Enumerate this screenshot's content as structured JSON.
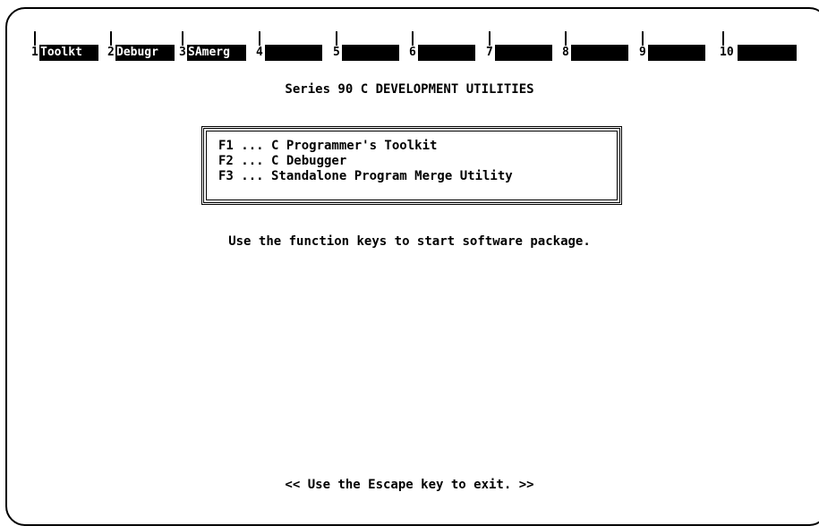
{
  "function_keys": [
    {
      "number": "1",
      "label": "Toolkt"
    },
    {
      "number": "2",
      "label": "Debugr"
    },
    {
      "number": "3",
      "label": "SAmerg"
    },
    {
      "number": "4",
      "label": ""
    },
    {
      "number": "5",
      "label": ""
    },
    {
      "number": "6",
      "label": ""
    },
    {
      "number": "7",
      "label": ""
    },
    {
      "number": "8",
      "label": ""
    },
    {
      "number": "9",
      "label": ""
    },
    {
      "number": "10",
      "label": ""
    }
  ],
  "title": "Series 90 C DEVELOPMENT UTILITIES",
  "menu": {
    "items": [
      {
        "text": "F1 ... C Programmer's Toolkit"
      },
      {
        "text": "F2 ... C Debugger"
      },
      {
        "text": "F3 ... Standalone Program Merge Utility"
      }
    ]
  },
  "instruction": "Use the function keys to start software package.",
  "exit_hint": "<< Use the Escape key to exit. >>"
}
